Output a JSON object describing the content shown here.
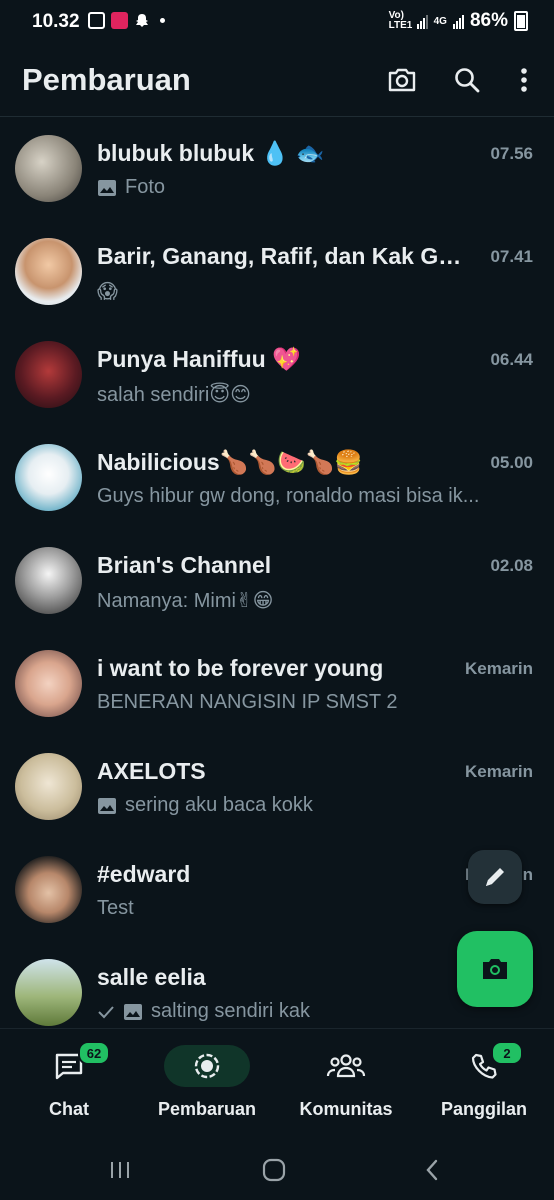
{
  "status_bar": {
    "time": "10.32",
    "network_label": "Vo) LTE1",
    "network_type": "4G",
    "battery": "86%"
  },
  "header": {
    "title": "Pembaruan",
    "icons": [
      "camera-icon",
      "search-icon",
      "more-icon"
    ]
  },
  "chats": [
    {
      "name": "blubuk blubuk 💧 🐟",
      "time": "07.56",
      "preview": "Foto",
      "has_image_icon": true,
      "has_check": false
    },
    {
      "name": "Barir, Ganang, Rafif, dan Kak Ge...",
      "time": "07.41",
      "preview": "😱",
      "has_image_icon": false,
      "has_check": false
    },
    {
      "name": "Punya Haniffuu 💖",
      "time": "06.44",
      "preview": "salah sendiri😇😊",
      "has_image_icon": false,
      "has_check": false
    },
    {
      "name": "Nabilicious🍗🍗🍉🍗🍔",
      "time": "05.00",
      "preview": "Guys hibur gw dong, ronaldo masi bisa ik...",
      "has_image_icon": false,
      "has_check": false
    },
    {
      "name": "Brian's Channel",
      "time": "02.08",
      "preview": "Namanya: Mimi✌😁",
      "has_image_icon": false,
      "has_check": false
    },
    {
      "name": "i want to be forever young",
      "time": "Kemarin",
      "preview": "BENERAN NANGISIN IP SMST 2",
      "has_image_icon": false,
      "has_check": false
    },
    {
      "name": "AXELOTS",
      "time": "Kemarin",
      "preview": "sering aku baca kokk",
      "has_image_icon": true,
      "has_check": false
    },
    {
      "name": "#edward",
      "time": "Kemarin",
      "preview": "Test",
      "has_image_icon": false,
      "has_check": false
    },
    {
      "name": "salle eelia",
      "time": "",
      "preview": "salting sendiri kak",
      "has_image_icon": true,
      "has_check": true
    }
  ],
  "bottom_nav": [
    {
      "label": "Chat",
      "badge": "62",
      "icon": "chat-icon",
      "active": false
    },
    {
      "label": "Pembaruan",
      "badge": "",
      "icon": "status-icon",
      "active": true
    },
    {
      "label": "Komunitas",
      "badge": "",
      "icon": "community-icon",
      "active": false
    },
    {
      "label": "Panggilan",
      "badge": "2",
      "icon": "phone-icon",
      "active": false
    }
  ],
  "colors": {
    "background": "#0b141a",
    "accent": "#21c063",
    "secondary_text": "#8696a0",
    "active_nav_pill": "#103529"
  }
}
